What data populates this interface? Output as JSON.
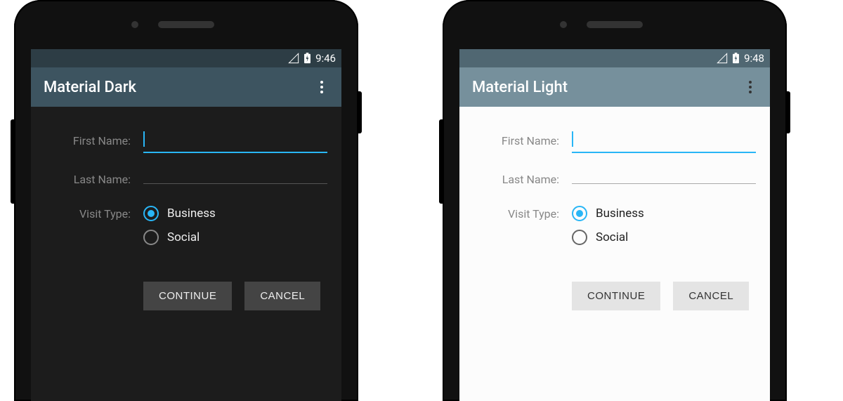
{
  "phones": {
    "dark": {
      "status_time": "9:46",
      "app_title": "Material Dark"
    },
    "light": {
      "status_time": "9:48",
      "app_title": "Material Light"
    }
  },
  "form": {
    "first_name_label": "First Name:",
    "first_name_value": "",
    "last_name_label": "Last Name:",
    "last_name_value": "",
    "visit_type_label": "Visit Type:",
    "radio_business": "Business",
    "radio_social": "Social"
  },
  "buttons": {
    "continue": "CONTINUE",
    "cancel": "CANCEL"
  },
  "icons": {
    "signal": "signal-icon",
    "battery": "battery-charging-icon",
    "menu": "more-vert-icon"
  }
}
